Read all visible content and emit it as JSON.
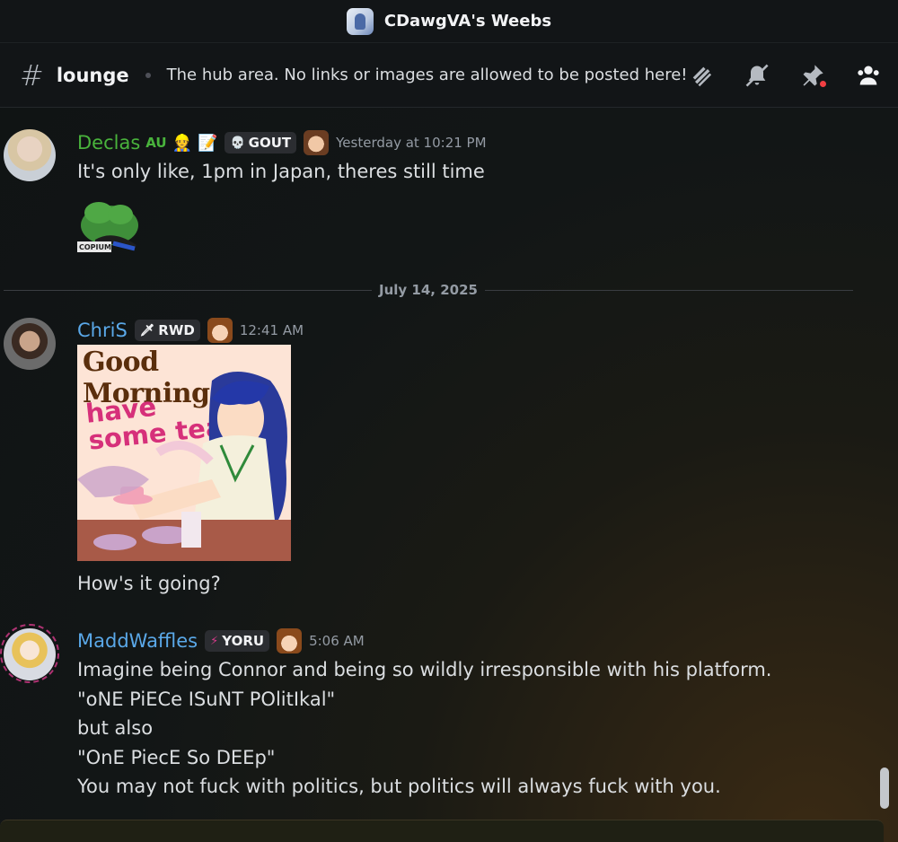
{
  "titlebar": {
    "server_name": "CDawgVA's Weebs"
  },
  "channel": {
    "name": "lounge",
    "topic": "The hub area. No links or images are allowed to be posted here!",
    "icons": [
      "threads-icon",
      "notifications-muted-icon",
      "pinned-messages-icon",
      "member-list-icon"
    ]
  },
  "divider": {
    "date": "July 14, 2025"
  },
  "messages": [
    {
      "username": "Declas",
      "username_color": "#49b33c",
      "tag_text": "AU",
      "emojis": [
        "👷",
        "📝"
      ],
      "guild_tag": "GOUT",
      "guild_tag_icon": "💀",
      "timestamp": "Yesterday at 10:21 PM",
      "lines": [
        "It's only like, 1pm in Japan, theres still time"
      ],
      "sticker_caption": "COPIUM"
    },
    {
      "username": "ChriS",
      "username_color": "#5aa8e8",
      "guild_tag": "RWD",
      "guild_tag_icon": "🗡",
      "timestamp": "12:41 AM",
      "image_text": {
        "title": "Good Morning!",
        "subtitle_1": "have",
        "subtitle_2": "some tea"
      },
      "lines": [
        "How's it going?"
      ]
    },
    {
      "username": "MaddWaffles",
      "username_color": "#5aa8e8",
      "guild_tag": "YORU",
      "guild_tag_icon": "⚡",
      "timestamp": "5:06 AM",
      "lines": [
        "Imagine being Connor and being so wildly irresponsible with his platform.",
        "\"oNE PiECe ISuNT POlitIkal\"",
        "but also",
        "\"OnE PiecE So DEEp\"",
        "You may not fuck with politics, but politics will always fuck with you."
      ]
    }
  ]
}
